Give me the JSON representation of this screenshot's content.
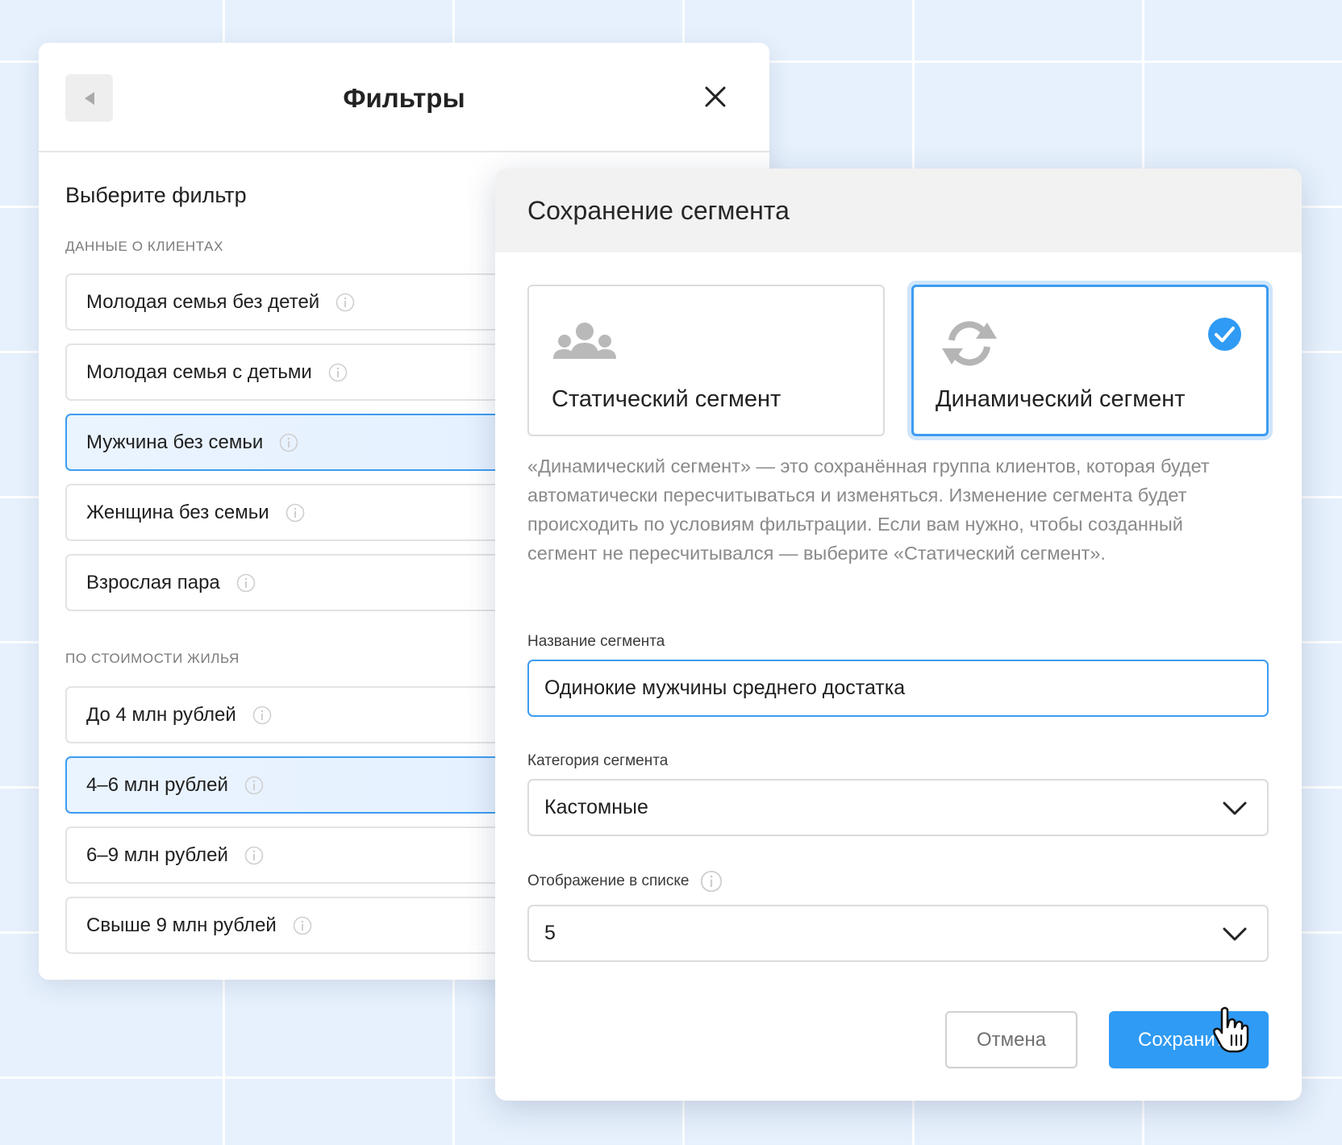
{
  "filters_panel": {
    "title": "Фильтры",
    "subtitle": "Выберите фильтр",
    "sections": [
      {
        "label": "ДАННЫЕ О КЛИЕНТАХ",
        "items": [
          {
            "label": "Молодая семья без детей",
            "selected": false
          },
          {
            "label": "Молодая семья с детьми",
            "selected": false
          },
          {
            "label": "Мужчина без семьи",
            "selected": true
          },
          {
            "label": "Женщина без семьи",
            "selected": false
          },
          {
            "label": "Взрослая пара",
            "selected": false
          }
        ]
      },
      {
        "label": "ПО СТОИМОСТИ ЖИЛЬЯ",
        "items": [
          {
            "label": "До 4 млн рублей",
            "selected": false
          },
          {
            "label": "4–6 млн рублей",
            "selected": true
          },
          {
            "label": "6–9 млн рублей",
            "selected": false
          },
          {
            "label": "Свыше 9 млн рублей",
            "selected": false
          }
        ]
      }
    ]
  },
  "modal": {
    "title": "Сохранение сегмента",
    "segment_types": [
      {
        "label": "Статический сегмент",
        "icon": "users-group-icon",
        "selected": false
      },
      {
        "label": "Динамический сегмент",
        "icon": "refresh-icon",
        "selected": true
      }
    ],
    "description": "«Динамический сегмент» — это сохранённая группа клиентов, которая будет автоматически пересчитываться и изменяться. Изменение сегмента будет происходить по условиям фильтрации. Если вам нужно, чтобы созданный сегмент не пересчитывался — выберите «Статический сегмент».",
    "name_field": {
      "label": "Название сегмента",
      "value": "Одинокие мужчины среднего достатка"
    },
    "category_field": {
      "label": "Категория сегмента",
      "value": "Кастомные"
    },
    "display_field": {
      "label": "Отображение в списке",
      "value": "5"
    },
    "cancel_label": "Отмена",
    "save_label": "Сохранить"
  },
  "colors": {
    "accent": "#2f9bf4",
    "selected_bg": "#e7f2ff",
    "background": "#e7f1fd"
  }
}
